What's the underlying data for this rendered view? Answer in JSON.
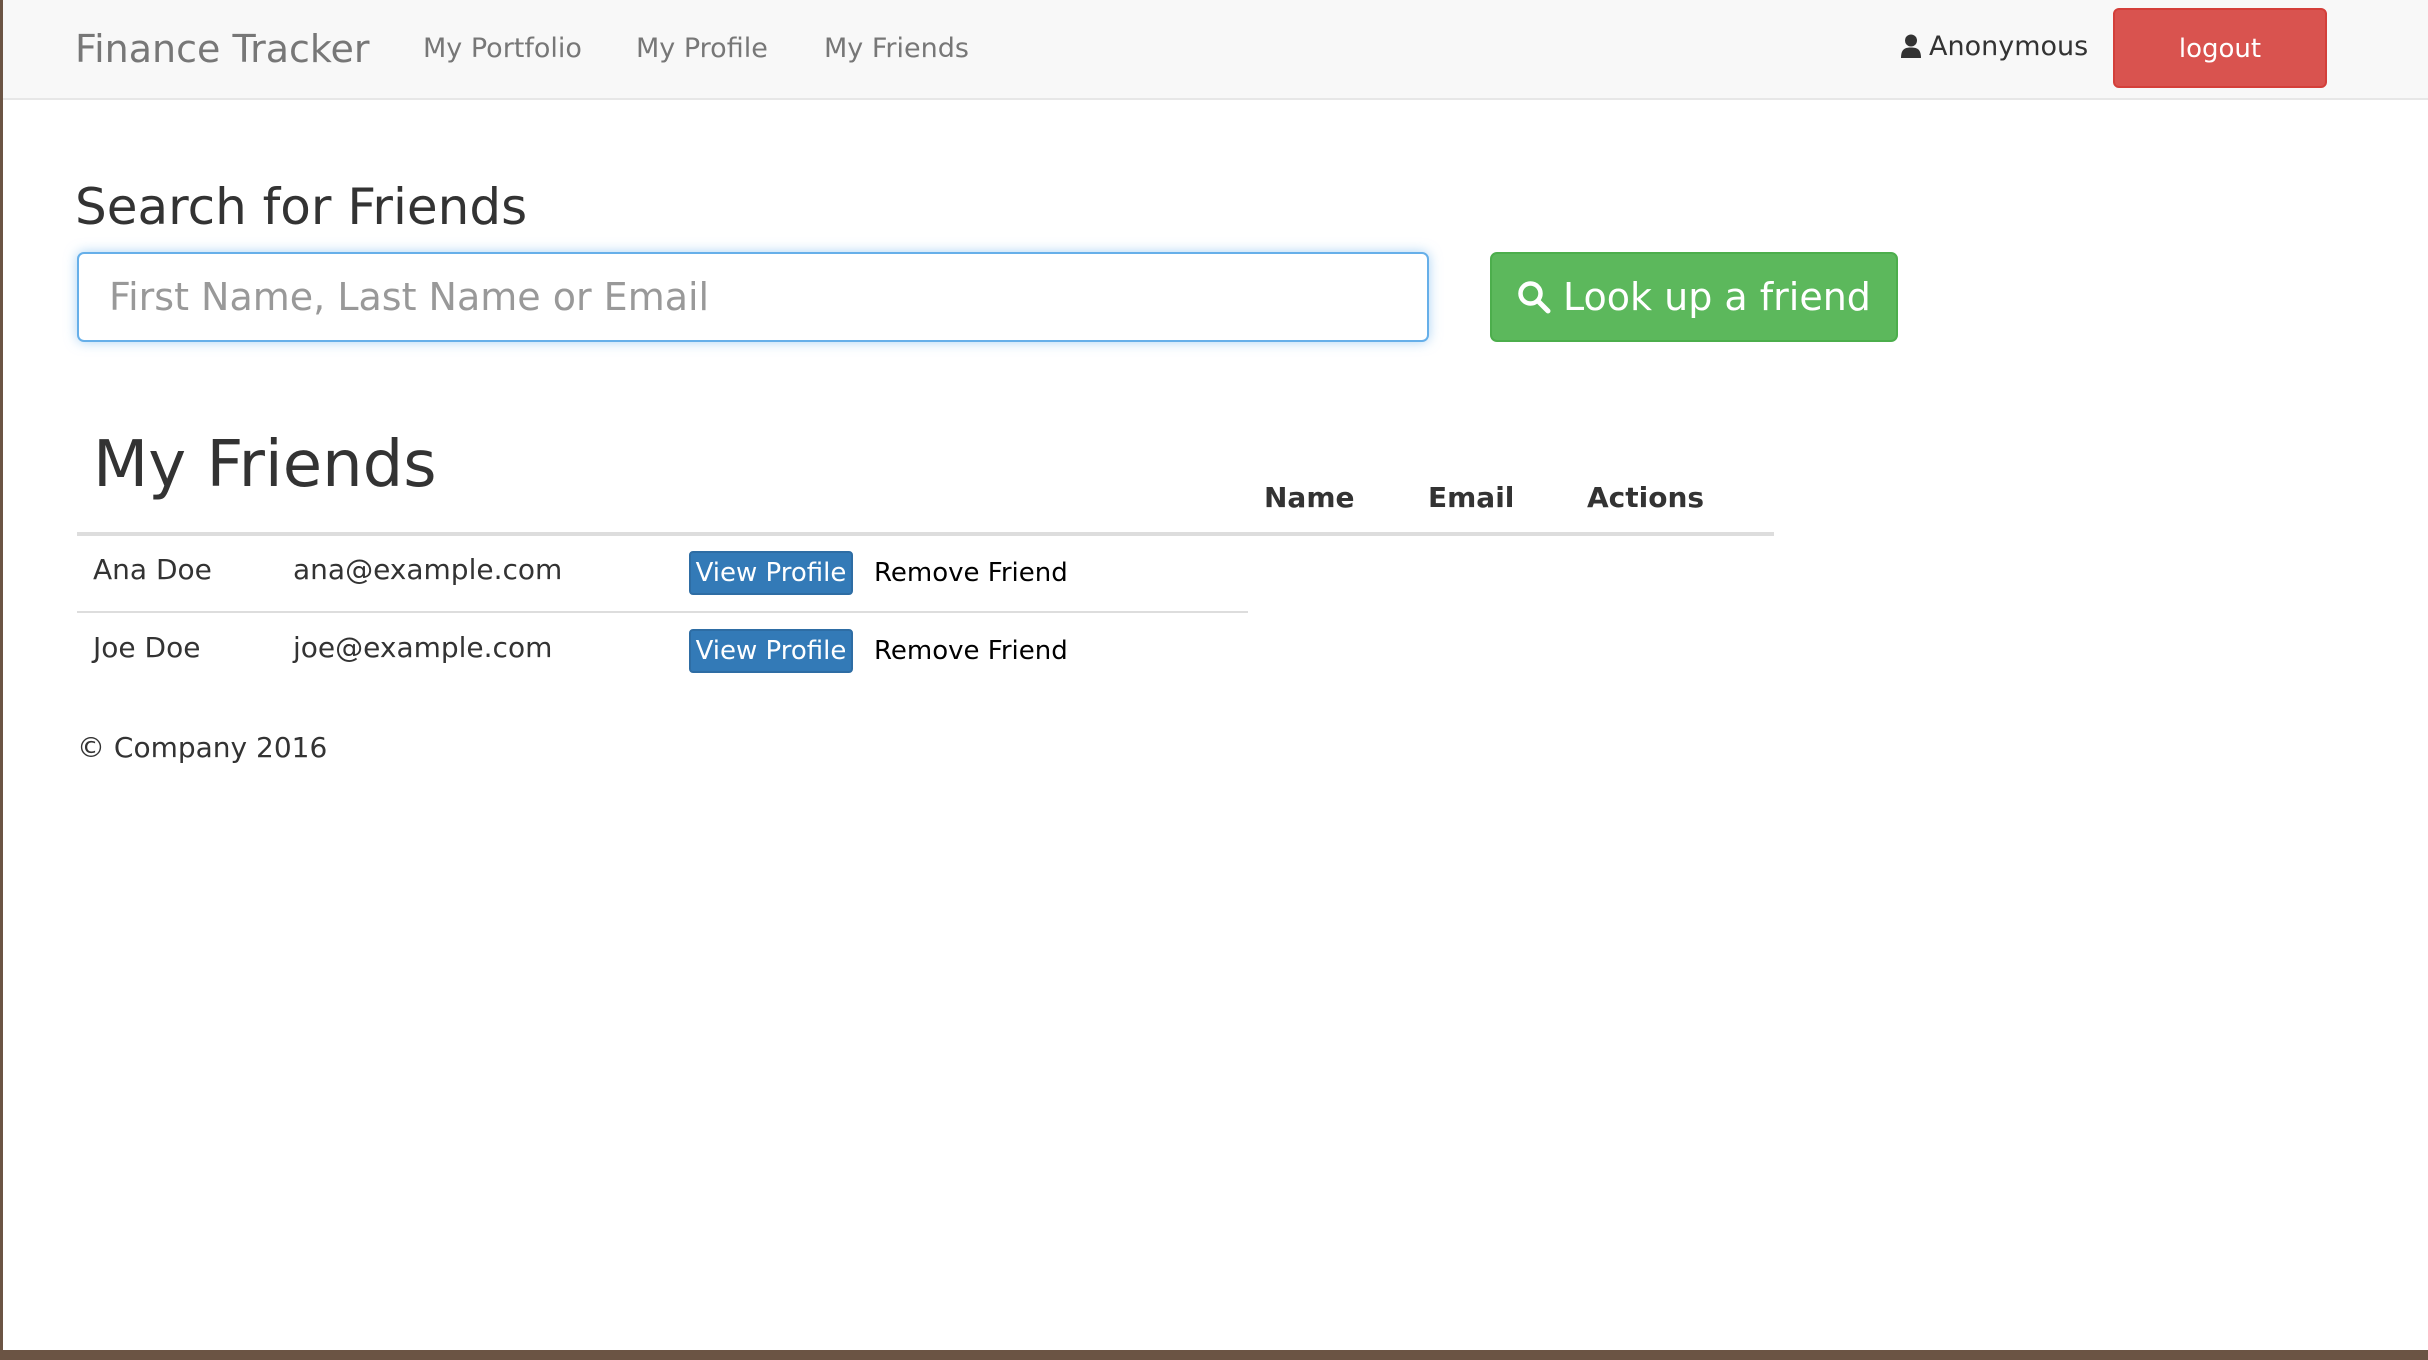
{
  "navbar": {
    "brand": "Finance Tracker",
    "links": [
      "My Portfolio",
      "My Profile",
      "My Friends"
    ],
    "user_name": "Anonymous",
    "logout_label": "logout"
  },
  "search": {
    "title": "Search for Friends",
    "placeholder": "First Name, Last Name or Email",
    "button_label": "Look up a friend"
  },
  "friends": {
    "title": "My Friends",
    "columns": [
      "Name",
      "Email",
      "Actions"
    ],
    "rows": [
      {
        "name": "Ana Doe",
        "email": "ana@example.com",
        "view_label": "View Profile",
        "remove_label": "Remove Friend"
      },
      {
        "name": "Joe Doe",
        "email": "joe@example.com",
        "view_label": "View Profile",
        "remove_label": "Remove Friend"
      }
    ]
  },
  "footer": {
    "text": "© Company 2016"
  },
  "colors": {
    "logout": "#d9534f",
    "lookup": "#5cb85c",
    "view_profile": "#337ab7",
    "input_focus": "#66afe9"
  }
}
